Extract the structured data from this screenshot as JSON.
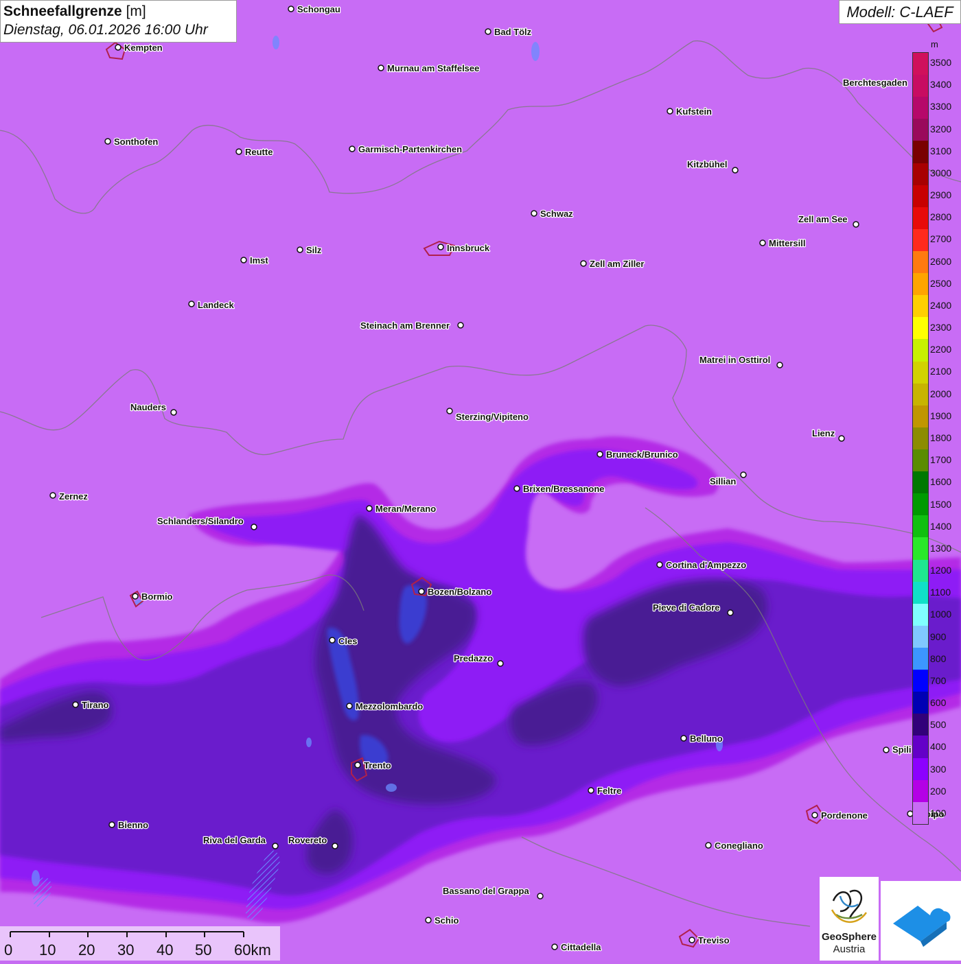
{
  "title": {
    "main": "Schneefallgrenze",
    "unit": "[m]",
    "datetime": "Dienstag, 06.01.2026 16:00 Uhr"
  },
  "model": "Modell: C-LAEF",
  "legend": {
    "unit": "m",
    "entries": [
      {
        "label": "3500",
        "color": "#d0105c"
      },
      {
        "label": "3400",
        "color": "#c80c62"
      },
      {
        "label": "3300",
        "color": "#b6086a"
      },
      {
        "label": "3200",
        "color": "#9a0a5c"
      },
      {
        "label": "3100",
        "color": "#7a0000"
      },
      {
        "label": "3000",
        "color": "#a80000"
      },
      {
        "label": "2900",
        "color": "#c80000"
      },
      {
        "label": "2800",
        "color": "#e80a0a"
      },
      {
        "label": "2700",
        "color": "#ff2a1e"
      },
      {
        "label": "2600",
        "color": "#ff7a10"
      },
      {
        "label": "2500",
        "color": "#ffa400"
      },
      {
        "label": "2400",
        "color": "#ffcf00"
      },
      {
        "label": "2300",
        "color": "#ffff00"
      },
      {
        "label": "2200",
        "color": "#c8f000"
      },
      {
        "label": "2100",
        "color": "#d2d200"
      },
      {
        "label": "2000",
        "color": "#c8b400"
      },
      {
        "label": "1900",
        "color": "#c09600"
      },
      {
        "label": "1800",
        "color": "#8c8c00"
      },
      {
        "label": "1700",
        "color": "#5a8c00"
      },
      {
        "label": "1600",
        "color": "#007800"
      },
      {
        "label": "1500",
        "color": "#009a00"
      },
      {
        "label": "1400",
        "color": "#10c010"
      },
      {
        "label": "1300",
        "color": "#2ae82a"
      },
      {
        "label": "1200",
        "color": "#20e690"
      },
      {
        "label": "1100",
        "color": "#10e0c8"
      },
      {
        "label": "1000",
        "color": "#80ffff"
      },
      {
        "label": "900",
        "color": "#80c8ff"
      },
      {
        "label": "800",
        "color": "#3c96ff"
      },
      {
        "label": "700",
        "color": "#0000ff"
      },
      {
        "label": "600",
        "color": "#0000b4"
      },
      {
        "label": "500",
        "color": "#32007a"
      },
      {
        "label": "400",
        "color": "#6400c8"
      },
      {
        "label": "300",
        "color": "#8c00ff"
      },
      {
        "label": "200",
        "color": "#b400e6"
      },
      {
        "label": "100",
        "color": "#c86cf5"
      }
    ]
  },
  "cities": [
    {
      "name": "Schongau"
    },
    {
      "name": "Bad Tölz"
    },
    {
      "name": "Kempten"
    },
    {
      "name": "Murnau am Staffelsee"
    },
    {
      "name": "Berchtesgaden"
    },
    {
      "name": "Kufstein"
    },
    {
      "name": "Sonthofen"
    },
    {
      "name": "Reutte"
    },
    {
      "name": "Garmisch-Partenkirchen"
    },
    {
      "name": "Kitzbühel"
    },
    {
      "name": "Schwaz"
    },
    {
      "name": "Zell am See"
    },
    {
      "name": "Innsbruck"
    },
    {
      "name": "Mittersill"
    },
    {
      "name": "Silz"
    },
    {
      "name": "Imst"
    },
    {
      "name": "Zell am Ziller"
    },
    {
      "name": "Landeck"
    },
    {
      "name": "Steinach am Brenner"
    },
    {
      "name": "Matrei in Osttirol"
    },
    {
      "name": "Nauders"
    },
    {
      "name": "Sterzing/Vipiteno"
    },
    {
      "name": "Lienz"
    },
    {
      "name": "Bruneck/Brunico"
    },
    {
      "name": "Sillian"
    },
    {
      "name": "Zernez"
    },
    {
      "name": "Brixen/Bressanone"
    },
    {
      "name": "Meran/Merano"
    },
    {
      "name": "Schlanders/Silandro"
    },
    {
      "name": "Cortina d'Ampezzo"
    },
    {
      "name": "Bozen/Bolzano"
    },
    {
      "name": "Bormio"
    },
    {
      "name": "Pieve di Cadore"
    },
    {
      "name": "Cles"
    },
    {
      "name": "Predazzo"
    },
    {
      "name": "Tirano"
    },
    {
      "name": "Mezzolombardo"
    },
    {
      "name": "Belluno"
    },
    {
      "name": "Spili"
    },
    {
      "name": "Trento"
    },
    {
      "name": "Feltre"
    },
    {
      "name": "Bienno"
    },
    {
      "name": "Pordenone"
    },
    {
      "name": "droipo"
    },
    {
      "name": "Riva del Garda"
    },
    {
      "name": "Rovereto"
    },
    {
      "name": "Conegliano"
    },
    {
      "name": "Bassano del Grappa"
    },
    {
      "name": "Schio"
    },
    {
      "name": "Treviso"
    },
    {
      "name": "Cittadella"
    }
  ],
  "scalebar": {
    "labels": [
      "0",
      "10",
      "20",
      "30",
      "40",
      "50",
      "60km"
    ]
  },
  "logos": {
    "geosphere_line1": "GeoSphere",
    "geosphere_line2": "Austria"
  }
}
